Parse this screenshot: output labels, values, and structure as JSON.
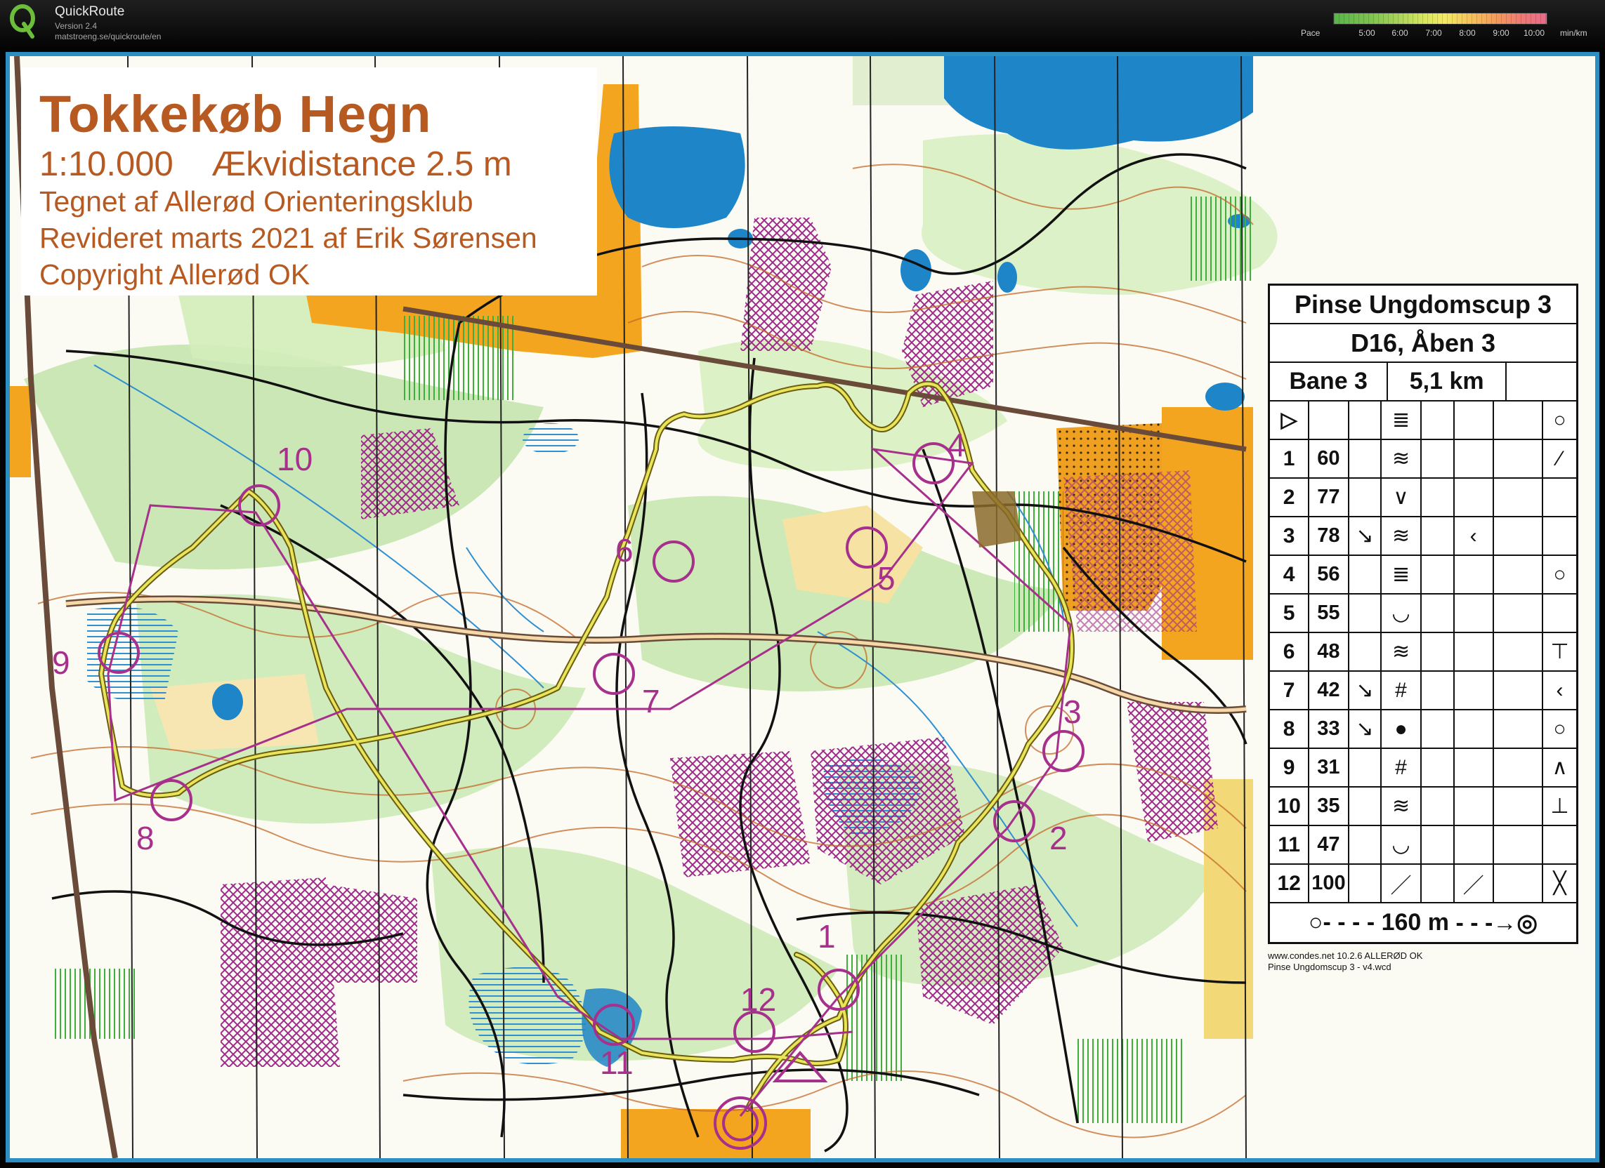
{
  "app": {
    "name": "QuickRoute",
    "version": "Version 2.4",
    "url": "matstroeng.se/quickroute/en"
  },
  "pace_legend": {
    "label": "Pace",
    "ticks": [
      "5:00",
      "6:00",
      "7:00",
      "8:00",
      "9:00",
      "10:00"
    ],
    "unit": "min/km"
  },
  "map": {
    "title": "Tokkekøb Hegn",
    "scale": "1:10.000    Ækvidistance 2.5 m",
    "drawn_by": "Tegnet af Allerød Orienteringsklub",
    "revised": "Revideret marts 2021 af Erik Sørensen",
    "copyright": "Copyright Allerød OK",
    "control_numbers": [
      "1",
      "2",
      "3",
      "4",
      "5",
      "6",
      "7",
      "8",
      "9",
      "10",
      "11",
      "12"
    ]
  },
  "control_description": {
    "event": "Pinse Ungdomscup 3",
    "class": "D16, Åben 3",
    "course": "Bane 3",
    "length": "5,1 km",
    "start_symbol": "▷",
    "rows": [
      {
        "num": "1",
        "code": "60"
      },
      {
        "num": "2",
        "code": "77"
      },
      {
        "num": "3",
        "code": "78"
      },
      {
        "num": "4",
        "code": "56"
      },
      {
        "num": "5",
        "code": "55"
      },
      {
        "num": "6",
        "code": "48"
      },
      {
        "num": "7",
        "code": "42"
      },
      {
        "num": "8",
        "code": "33"
      },
      {
        "num": "9",
        "code": "31"
      },
      {
        "num": "10",
        "code": "35"
      },
      {
        "num": "11",
        "code": "47"
      },
      {
        "num": "12",
        "code": "100"
      }
    ],
    "finish": "160 m",
    "software": "www.condes.net 10.2.6 ALLERØD OK",
    "file": "Pinse Ungdomscup 3 - v4.wcd"
  }
}
